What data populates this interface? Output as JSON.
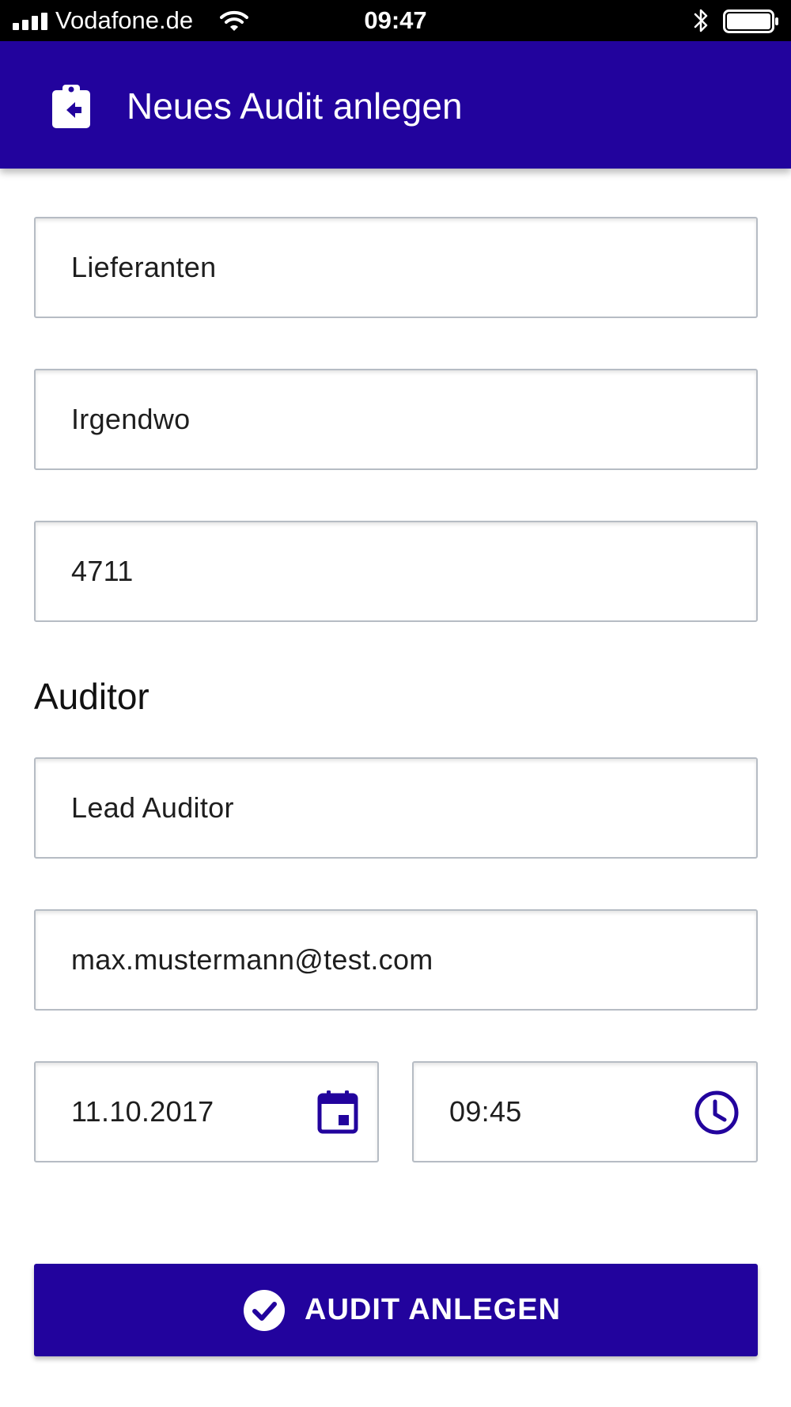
{
  "status_bar": {
    "carrier": "Vodafone.de",
    "time": "09:47",
    "icons": [
      "signal-icon",
      "wifi-icon",
      "bluetooth-icon",
      "battery-icon"
    ]
  },
  "header": {
    "title": "Neues Audit anlegen",
    "back_icon": "clipboard-back-icon",
    "color": "#22039d"
  },
  "form": {
    "clipped_section_label": "",
    "fields": {
      "lieferant": {
        "value": "Lieferanten"
      },
      "ort": {
        "value": "Irgendwo"
      },
      "nummer": {
        "value": "4711"
      }
    },
    "auditor_section": {
      "heading": "Auditor",
      "role": {
        "value": "Lead Auditor"
      },
      "email": {
        "value": "max.mustermann@test.com"
      },
      "date": {
        "value": "11.10.2017",
        "icon": "calendar-icon"
      },
      "time": {
        "value": "09:45",
        "icon": "clock-icon"
      }
    }
  },
  "submit_button": {
    "label": "AUDIT ANLEGEN",
    "icon": "check-circle-icon",
    "color": "#22039d"
  }
}
